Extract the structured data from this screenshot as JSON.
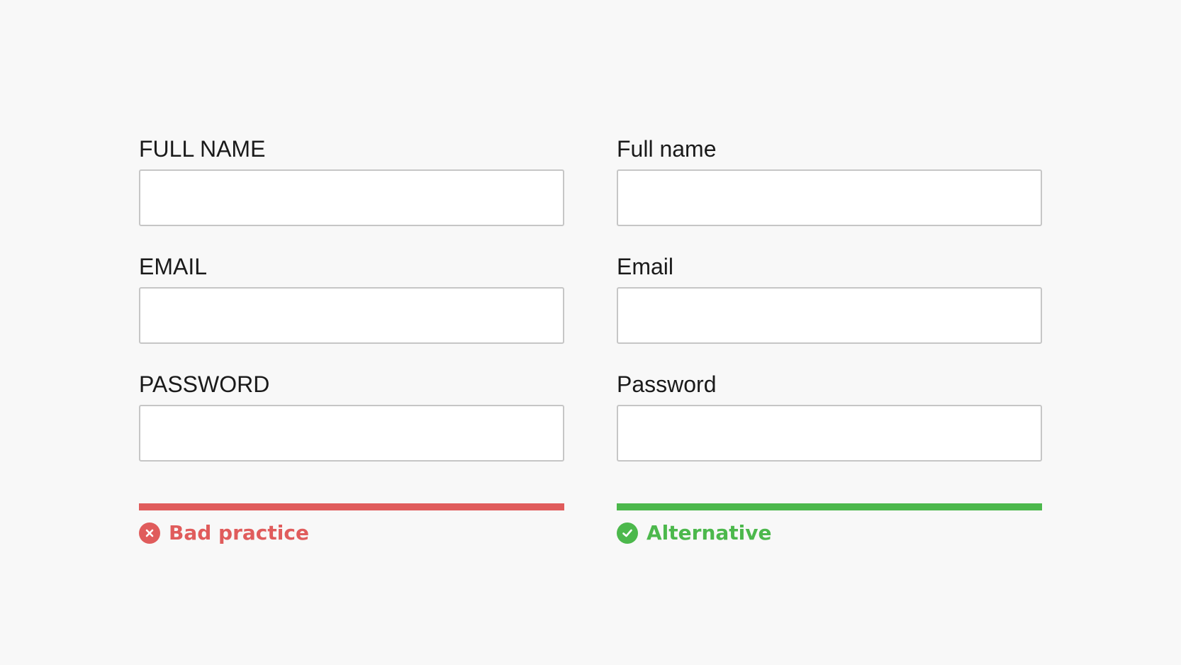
{
  "bad": {
    "fields": [
      {
        "label": "FULL NAME",
        "value": ""
      },
      {
        "label": "EMAIL",
        "value": ""
      },
      {
        "label": "PASSWORD",
        "value": ""
      }
    ],
    "verdict": {
      "text": "Bad practice",
      "icon": "close-circle-icon",
      "color": "#e05c5c"
    }
  },
  "good": {
    "fields": [
      {
        "label": "Full name",
        "value": ""
      },
      {
        "label": "Email",
        "value": ""
      },
      {
        "label": "Password",
        "value": ""
      }
    ],
    "verdict": {
      "text": "Alternative",
      "icon": "check-circle-icon",
      "color": "#4cb84c"
    }
  }
}
